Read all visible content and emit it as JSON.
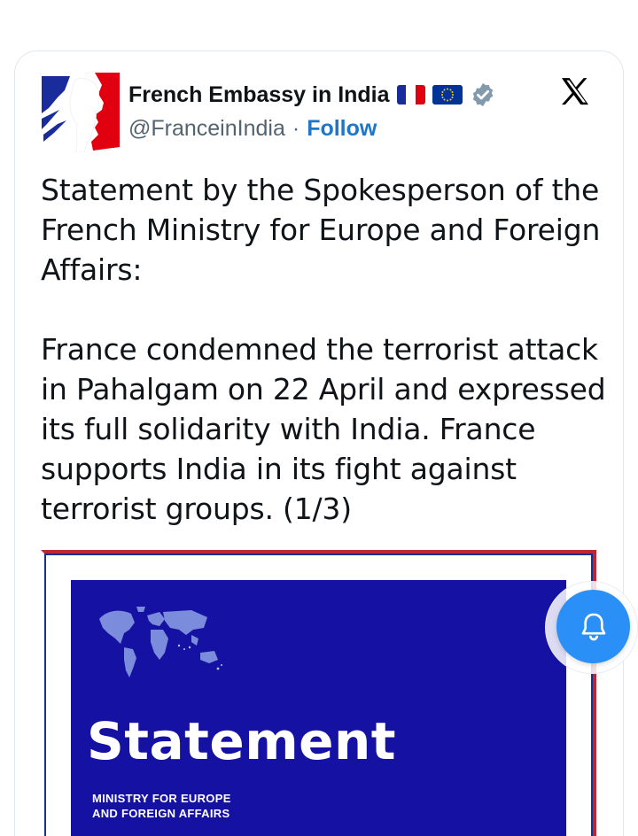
{
  "tweet": {
    "display_name": "French Embassy in India",
    "handle": "@FranceinIndia",
    "separator": "·",
    "follow_label": "Follow",
    "flags": [
      "france-flag",
      "eu-flag"
    ],
    "verified_icon": "verified-badge-icon",
    "text_paragraphs": [
      "Statement by the Spokesperson of the French Ministry for Europe and Foreign Affairs:",
      "France condemned the terrorist attack in Pahalgam on 22 April and expressed its full solidarity with India. France supports India in its fight against terrorist groups. (1/3)"
    ]
  },
  "media": {
    "title": "Statement",
    "subtitle_line1": "MINISTRY FOR EUROPE",
    "subtitle_line2": "AND FOREIGN AFFAIRS",
    "panel_color": "#1511a3",
    "frame_color": "#c0262d"
  },
  "colors": {
    "follow": "#1d76c9",
    "handle": "#536471",
    "bell_button": "#2a8ff7"
  },
  "icons": {
    "close_logo": "x-logo-icon",
    "notification": "bell-icon"
  }
}
